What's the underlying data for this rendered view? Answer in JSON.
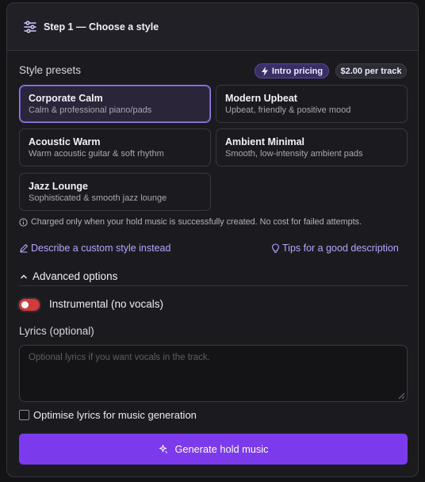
{
  "header": {
    "title": "Step 1 — Choose a style",
    "icon": "sliders-icon"
  },
  "presets_section": {
    "label": "Style presets",
    "badges": {
      "intro": {
        "label": "Intro pricing",
        "icon": "bolt-icon",
        "color": "#3a2f62"
      },
      "price": {
        "label": "$2.00 per track"
      }
    },
    "items": [
      {
        "name": "Corporate Calm",
        "desc": "Calm & professional piano/pads",
        "selected": true
      },
      {
        "name": "Modern Upbeat",
        "desc": "Upbeat, friendly & positive mood",
        "selected": false
      },
      {
        "name": "Acoustic Warm",
        "desc": "Warm acoustic guitar & soft rhythm",
        "selected": false
      },
      {
        "name": "Ambient Minimal",
        "desc": "Smooth, low-intensity ambient pads",
        "selected": false
      },
      {
        "name": "Jazz Lounge",
        "desc": "Sophisticated & smooth jazz lounge",
        "selected": false
      }
    ],
    "note": "Charged only when your hold music is successfully created. No cost for failed attempts."
  },
  "links": {
    "custom": "Describe a custom style instead",
    "tips": "Tips for a good description"
  },
  "advanced": {
    "label": "Advanced options",
    "expanded": true,
    "instrumental_label": "Instrumental (no vocals)",
    "instrumental_color": "#d33a3a",
    "lyrics_label": "Lyrics (optional)",
    "lyrics_placeholder": "Optional lyrics if you want vocals in the track.",
    "lyrics_value": "",
    "optimise_label": "Optimise lyrics for music generation",
    "optimise_checked": false
  },
  "generate": {
    "label": "Generate hold music",
    "color": "#7c3aed"
  }
}
